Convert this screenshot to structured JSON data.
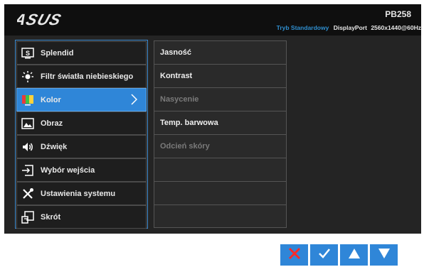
{
  "header": {
    "brand": "ASUS",
    "model": "PB258",
    "mode": "Tryb Standardowy",
    "input": "DisplayPort",
    "resolution": "2560x1440@60Hz"
  },
  "menu": {
    "items": [
      {
        "label": "Splendid",
        "icon": "splendid-icon"
      },
      {
        "label": "Filtr światła niebieskiego",
        "icon": "blue-light-icon"
      },
      {
        "label": "Kolor",
        "icon": "color-icon",
        "active": true
      },
      {
        "label": "Obraz",
        "icon": "image-icon"
      },
      {
        "label": "Dźwięk",
        "icon": "speaker-icon"
      },
      {
        "label": "Wybór wejścia",
        "icon": "input-select-icon"
      },
      {
        "label": "Ustawienia systemu",
        "icon": "tools-icon"
      },
      {
        "label": "Skrót",
        "icon": "shortcut-icon"
      }
    ]
  },
  "submenu": {
    "items": [
      {
        "label": "Jasność",
        "enabled": true
      },
      {
        "label": "Kontrast",
        "enabled": true
      },
      {
        "label": "Nasycenie",
        "enabled": false
      },
      {
        "label": "Temp. barwowa",
        "enabled": true
      },
      {
        "label": "Odcień skóry",
        "enabled": false
      }
    ]
  },
  "nav_buttons": [
    {
      "icon": "close-icon"
    },
    {
      "icon": "check-icon"
    },
    {
      "icon": "arrow-up-icon"
    },
    {
      "icon": "arrow-down-icon"
    }
  ],
  "colors": {
    "accent": "#2f86d8",
    "close_red": "#ff2a2a",
    "mode_text": "#2f8fd0"
  }
}
